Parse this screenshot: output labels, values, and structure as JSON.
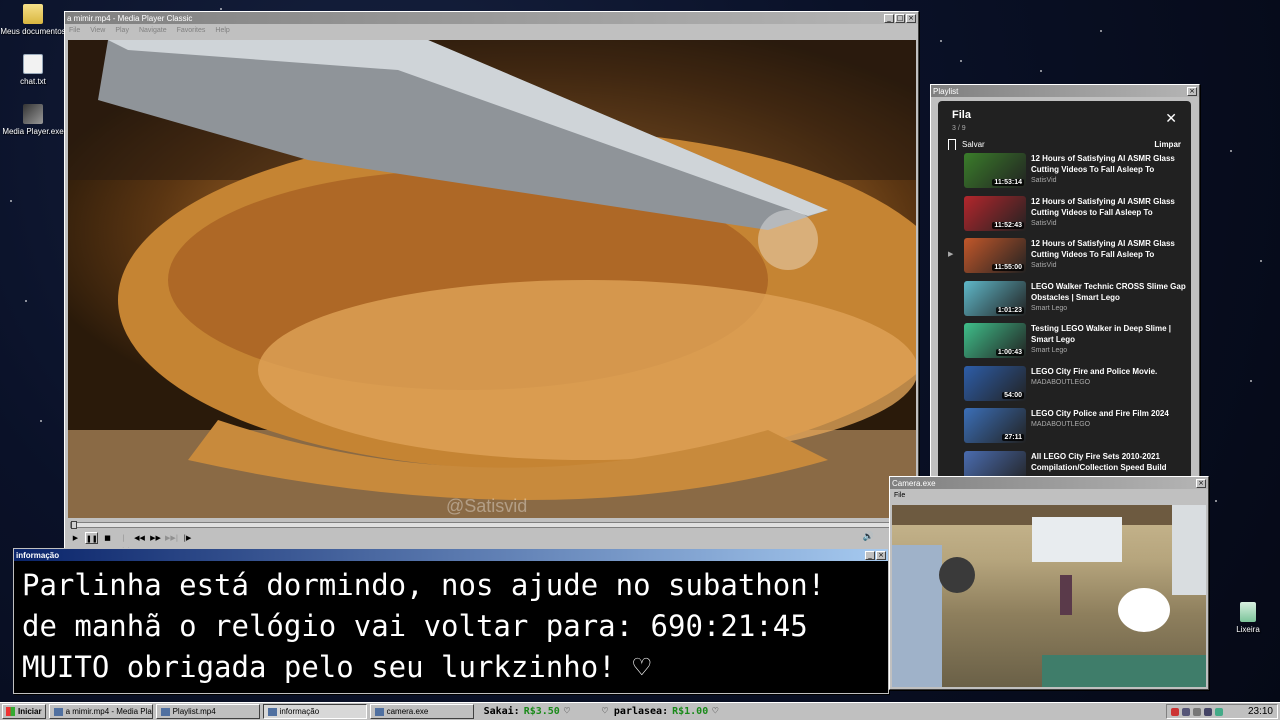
{
  "desktop": {
    "icons": [
      {
        "label": "Meus documentos",
        "icon": "folder-documents-icon"
      },
      {
        "label": "chat.txt",
        "icon": "text-file-icon"
      },
      {
        "label": "Media Player.exe",
        "icon": "media-player-icon"
      },
      {
        "label": "Lixeira",
        "icon": "recycle-bin-icon"
      }
    ]
  },
  "mpc": {
    "title": "a mimir.mp4 - Media Player Classic",
    "menu": [
      "File",
      "View",
      "Play",
      "Navigate",
      "Favorites",
      "Help"
    ],
    "watermark": "@Satisvid",
    "progress": 0.0,
    "controls": [
      "play",
      "pause",
      "stop",
      "prev",
      "rewind",
      "forward",
      "next",
      "frame-step"
    ]
  },
  "playlist_window": {
    "title": "Playlist",
    "panel_title": "Fila",
    "counter": "3 / 9",
    "save_label": "Salvar",
    "clear_label": "Limpar",
    "current_index": 2,
    "items": [
      {
        "title": "12 Hours of Satisfying AI ASMR Glass Cutting Videos To Fall Asleep To",
        "channel": "SatisVid",
        "duration": "11:53:14",
        "color": "#3a7d2a"
      },
      {
        "title": "12 Hours of Satisfying AI ASMR Glass Cutting Videos to Fall Asleep To",
        "channel": "SatisVid",
        "duration": "11:52:43",
        "color": "#b3262c"
      },
      {
        "title": "12 Hours of Satisfying AI ASMR Glass Cutting Videos To Fall Asleep To",
        "channel": "SatisVid",
        "duration": "11:55:00",
        "color": "#c2572a"
      },
      {
        "title": "LEGO Walker Technic CROSS Slime Gap Obstacles | Smart Lego",
        "channel": "Smart Lego",
        "duration": "1:01:23",
        "color": "#5fb8c9"
      },
      {
        "title": "Testing LEGO Walker in Deep Slime | Smart Lego",
        "channel": "Smart Lego",
        "duration": "1:00:43",
        "color": "#3fbf8a"
      },
      {
        "title": "LEGO City Fire and Police Movie.",
        "channel": "MADABOUTLEGO",
        "duration": "54:00",
        "color": "#2d5da8"
      },
      {
        "title": "LEGO City Police and Fire Film 2024",
        "channel": "MADABOUTLEGO",
        "duration": "27:11",
        "color": "#3b6fb8"
      },
      {
        "title": "All LEGO City Fire Sets 2010-2021 Compilation/Collection Speed Build",
        "channel": "",
        "duration": "",
        "color": "#4a6cb0"
      }
    ]
  },
  "info_window": {
    "title": "informação",
    "lines": [
      "Parlinha está dormindo, nos ajude no subathon!",
      "de manhã o relógio vai voltar para:  690:21:45",
      "MUITO obrigada pelo seu lurkzinho! ♡"
    ]
  },
  "camera_window": {
    "title": "Camera.exe",
    "menu": [
      "File"
    ]
  },
  "taskbar": {
    "start_label": "Iniciar",
    "tasks": [
      {
        "label": "a mimir.mp4 - Media Playe...",
        "active": false
      },
      {
        "label": "Playlist.mp4",
        "active": false
      },
      {
        "label": "informação",
        "active": true
      },
      {
        "label": "camera.exe",
        "active": false
      }
    ],
    "donations": [
      {
        "name": "Sakai:",
        "amount": "R$3.50",
        "heart": "♡"
      },
      {
        "name": "♡ parlasea:",
        "amount": "R$1.00",
        "heart": "♡"
      }
    ],
    "clock": "23:10"
  },
  "colors": {
    "desktop_bg": "#0a1128",
    "active_title": "#0a246a",
    "donation_green": "#1a8a1a",
    "playlist_bg": "#212121"
  }
}
